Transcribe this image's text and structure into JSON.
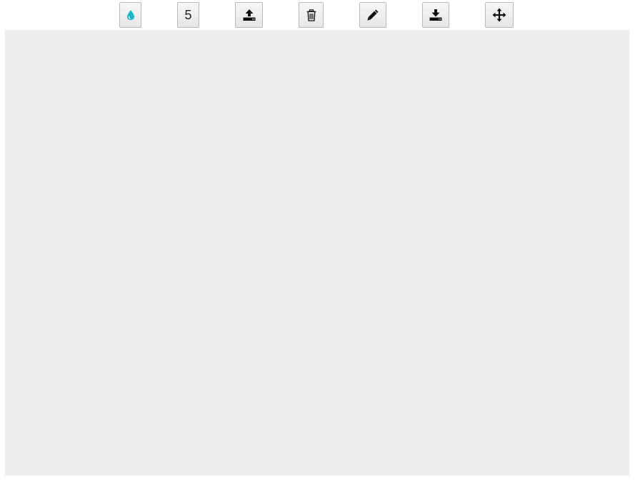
{
  "toolbar": {
    "buttons": [
      {
        "name": "color-button",
        "icon": "droplet-icon",
        "color": "#19b8c8"
      },
      {
        "name": "size-button",
        "label": "5"
      },
      {
        "name": "upload-button",
        "icon": "upload-icon"
      },
      {
        "name": "delete-button",
        "icon": "trash-icon"
      },
      {
        "name": "draw-button",
        "icon": "pencil-icon"
      },
      {
        "name": "download-button",
        "icon": "download-icon"
      },
      {
        "name": "move-button",
        "icon": "move-arrows-icon"
      }
    ]
  },
  "canvas": {
    "background": "#ececec"
  }
}
